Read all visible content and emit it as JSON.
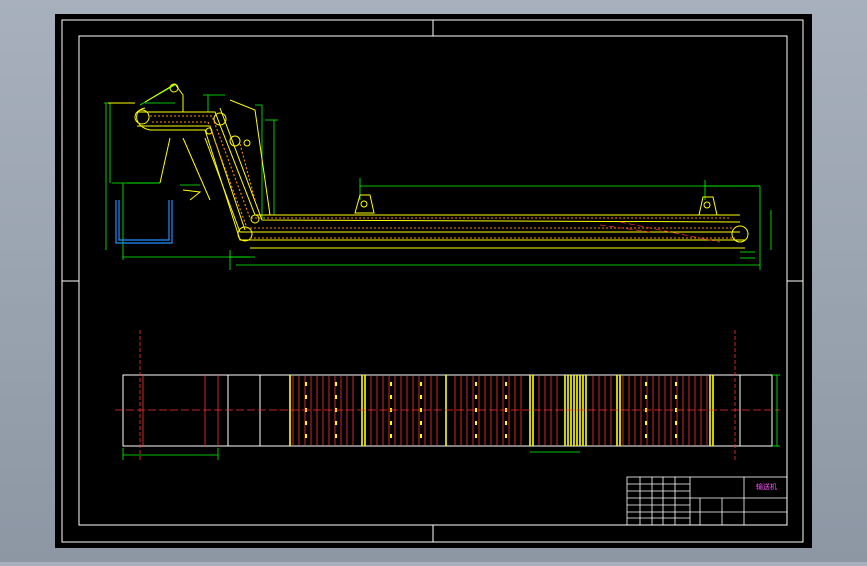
{
  "drawing": {
    "title_block": {
      "drawing_name": "输送机"
    }
  },
  "colors": {
    "viewer_background": "#98a2ae",
    "sheet_background": "#000000",
    "frame": "#ffffff",
    "conveyor_outline": "#ffff00",
    "dimension": "#00ff00",
    "centerline": "#ff3030",
    "hidden_detail": "#ff8c00",
    "section_lines": "#ffff00",
    "hopper": "#1e90ff",
    "annotation": "#ff4dff"
  }
}
